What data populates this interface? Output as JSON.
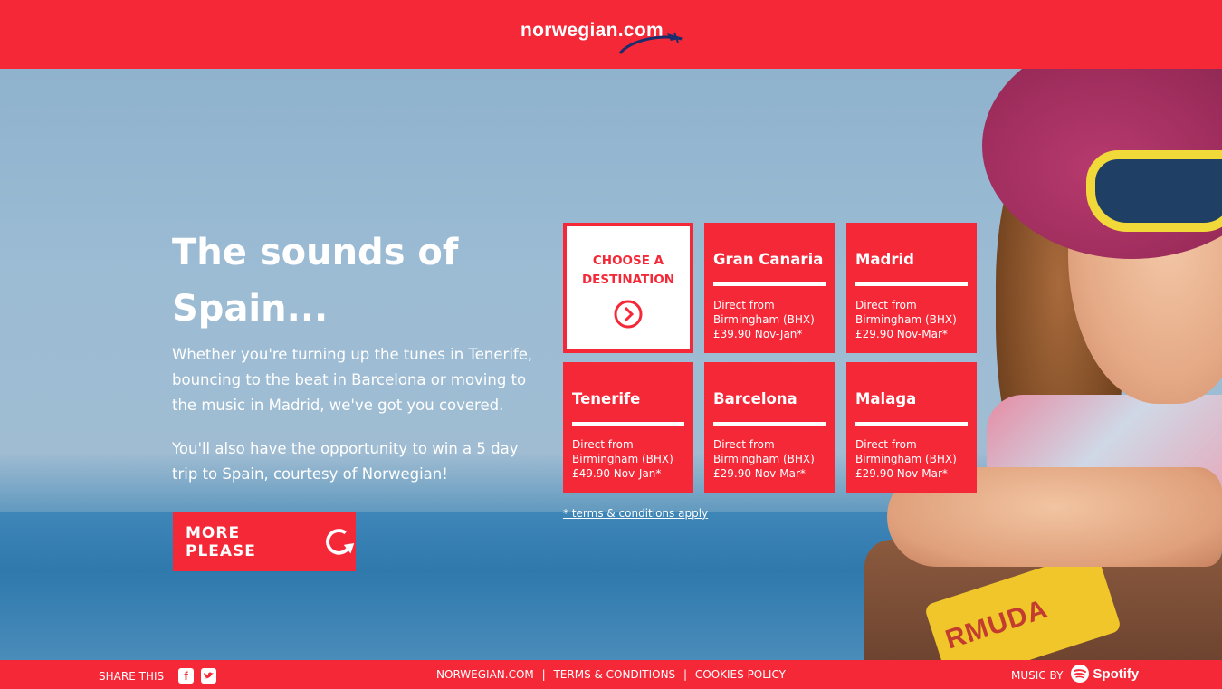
{
  "header": {
    "logo_text": "norwegian.com"
  },
  "hero": {
    "headline_line1": "The sounds of",
    "headline_line2": "Spain...",
    "intro": "Whether you're turning up the tunes in Tenerife, bouncing to the beat in Barcelona or moving to the music in Madrid, we've got you covered.",
    "intro2": "You'll also have the opportunity to win a 5 day trip to Spain, courtesy of Norwegian!",
    "more_button_label": "MORE PLEASE",
    "sticker_text": "RMUDA"
  },
  "destinations": {
    "choose_line1": "CHOOSE A",
    "choose_line2": "DESTINATION",
    "tiles": [
      {
        "name": "Gran Canaria",
        "line1": "Direct from",
        "line2": "Birmingham (BHX)",
        "line3": "£39.90 Nov-Jan*"
      },
      {
        "name": "Madrid",
        "line1": "Direct from",
        "line2": "Birmingham (BHX)",
        "line3": "£29.90 Nov-Mar*"
      },
      {
        "name": "Tenerife",
        "line1": "Direct from",
        "line2": "Birmingham (BHX)",
        "line3": "£49.90 Nov-Jan*"
      },
      {
        "name": "Barcelona",
        "line1": "Direct from",
        "line2": "Birmingham (BHX)",
        "line3": "£29.90 Nov-Mar*"
      },
      {
        "name": "Malaga",
        "line1": "Direct from",
        "line2": "Birmingham (BHX)",
        "line3": "£29.90 Nov-Mar*"
      }
    ],
    "terms_link": "* terms & conditions apply"
  },
  "footer": {
    "share_label": "SHARE THIS",
    "facebook_icon": "facebook-icon",
    "twitter_icon": "twitter-icon",
    "link_site": "NORWEGIAN.COM",
    "link_terms": "TERMS & CONDITIONS",
    "link_cookies": "COOKIES POLICY",
    "separator": "|",
    "music_label": "MUSIC BY",
    "spotify_label": "Spotify"
  },
  "colors": {
    "brand_red": "#f52838",
    "navy": "#1d2d6b"
  }
}
